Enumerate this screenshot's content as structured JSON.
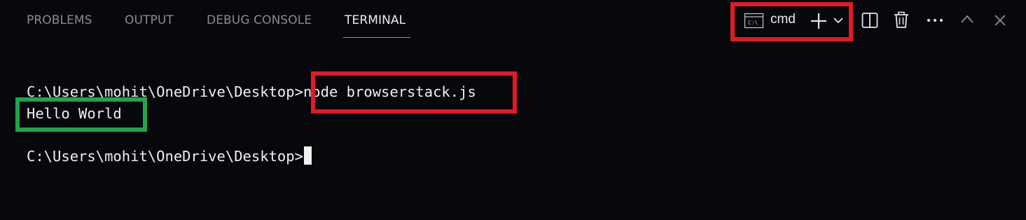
{
  "panel": {
    "tabs": [
      {
        "label": "PROBLEMS"
      },
      {
        "label": "OUTPUT"
      },
      {
        "label": "DEBUG CONSOLE"
      },
      {
        "label": "TERMINAL"
      }
    ],
    "active_tab": "TERMINAL"
  },
  "toolbar": {
    "shell_label": "cmd",
    "shell_icon_text": "C:\\",
    "icons": [
      "terminal-shell-icon",
      "plus-icon",
      "chevron-down-icon",
      "split-terminal-icon",
      "trash-icon",
      "more-actions-icon",
      "chevron-up-icon",
      "close-icon"
    ]
  },
  "terminal": {
    "lines": [
      {
        "prompt": "C:\\Users\\mohit\\OneDrive\\Desktop>",
        "command": "node browserstack.js"
      },
      {
        "output": "Hello World"
      },
      {
        "prompt": "C:\\Users\\mohit\\OneDrive\\Desktop>",
        "command": ""
      }
    ]
  },
  "colors": {
    "background": "#07080c",
    "active_tab": "#ededed",
    "inactive_tab": "#8a8a8f",
    "tab_underline": "#d57a5e",
    "highlight_red": "#e01b24",
    "highlight_green": "#1fa64a"
  }
}
